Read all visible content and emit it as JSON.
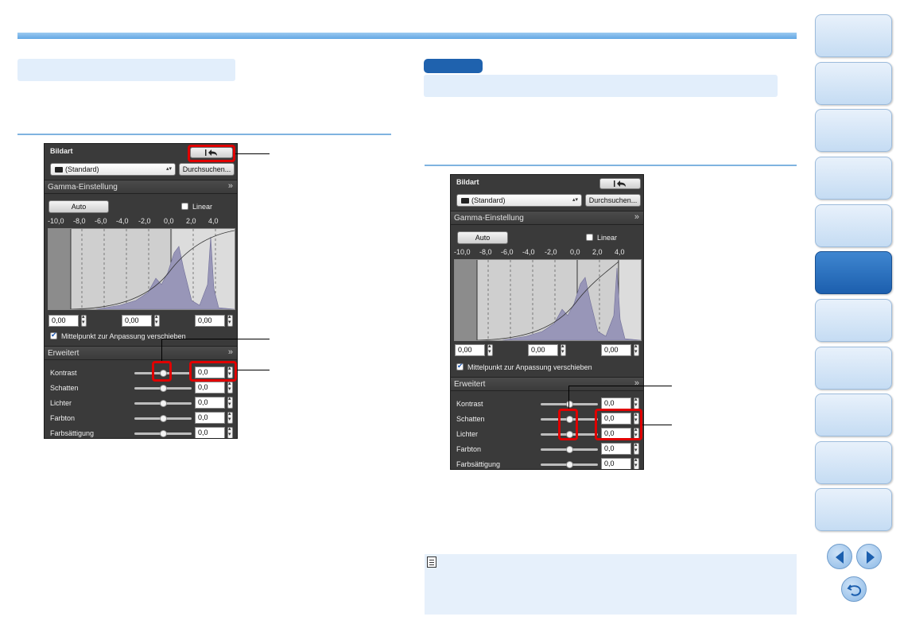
{
  "panels": [
    {
      "picture_style_label": "Bildart",
      "style_select_value": "(Standard)",
      "browse_button": "Durchsuchen...",
      "gamma_section": "Gamma-Einstellung",
      "auto_button": "Auto",
      "linear_label": "Linear",
      "ticks": [
        "-10,0",
        "-8,0",
        "-6,0",
        "-4,0",
        "-2,0",
        "0,0",
        "2,0",
        "4,0"
      ],
      "point_values": [
        "0,00",
        "0,00",
        "0,00"
      ],
      "midpoint_label": "Mittelpunkt zur Anpassung verschieben",
      "advanced_section": "Erweitert",
      "sliders": [
        {
          "label": "Kontrast",
          "value": "0,0"
        },
        {
          "label": "Schatten",
          "value": "0,0"
        },
        {
          "label": "Lichter",
          "value": "0,0"
        },
        {
          "label": "Farbton",
          "value": "0,0"
        },
        {
          "label": "Farbsättigung",
          "value": "0,0"
        }
      ]
    },
    {
      "picture_style_label": "Bildart",
      "style_select_value": "(Standard)",
      "browse_button": "Durchsuchen...",
      "gamma_section": "Gamma-Einstellung",
      "auto_button": "Auto",
      "linear_label": "Linear",
      "ticks": [
        "-10,0",
        "-8,0",
        "-6,0",
        "-4,0",
        "-2,0",
        "0,0",
        "2,0",
        "4,0"
      ],
      "point_values": [
        "0,00",
        "0,00",
        "0,00"
      ],
      "midpoint_label": "Mittelpunkt zur Anpassung verschieben",
      "advanced_section": "Erweitert",
      "sliders": [
        {
          "label": "Kontrast",
          "value": "0,0"
        },
        {
          "label": "Schatten",
          "value": "0,0"
        },
        {
          "label": "Lichter",
          "value": "0,0"
        },
        {
          "label": "Farbton",
          "value": "0,0"
        },
        {
          "label": "Farbsättigung",
          "value": "0,0"
        }
      ]
    }
  ],
  "icons": {
    "reset": "reset-arrow-icon",
    "camera": "camera-icon",
    "collapse": "double-chevron-icon",
    "prev": "arrow-left-icon",
    "next": "arrow-right-icon",
    "back": "return-icon",
    "note": "memo-icon"
  },
  "colors": {
    "accent": "#1f62ae",
    "highlight": "#e00000",
    "heading_bg": "#e2eefb"
  }
}
